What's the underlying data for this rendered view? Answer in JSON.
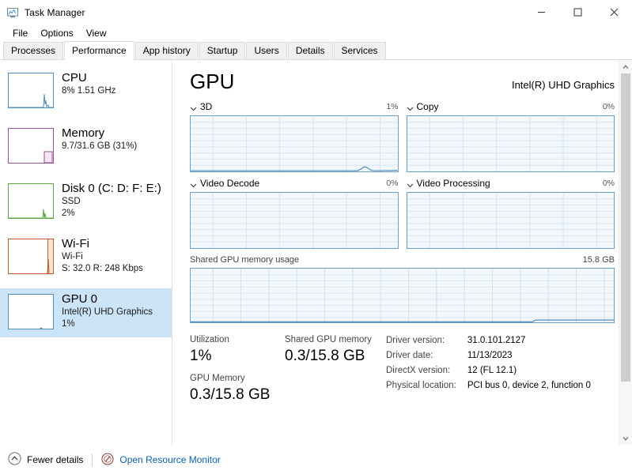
{
  "window": {
    "title": "Task Manager",
    "icon": "task-manager-icon",
    "controls": {
      "minimize": "minimize-icon",
      "maximize": "maximize-icon",
      "close": "close-icon"
    }
  },
  "menu": {
    "items": [
      {
        "label": "File"
      },
      {
        "label": "Options"
      },
      {
        "label": "View"
      }
    ]
  },
  "tabs": {
    "active": "Performance",
    "items": [
      {
        "label": "Processes"
      },
      {
        "label": "Performance"
      },
      {
        "label": "App history"
      },
      {
        "label": "Startup"
      },
      {
        "label": "Users"
      },
      {
        "label": "Details"
      },
      {
        "label": "Services"
      }
    ]
  },
  "sidebar": {
    "items": [
      {
        "title": "CPU",
        "line1": "8%  1.51 GHz",
        "line2": "",
        "line3": "",
        "color": "#4f8fc0",
        "selected": false
      },
      {
        "title": "Memory",
        "line1": "9.7/31.6 GB (31%)",
        "line2": "",
        "line3": "",
        "color": "#9b4f96",
        "selected": false
      },
      {
        "title": "Disk 0 (C: D: F: E:)",
        "line1": "SSD",
        "line2": "2%",
        "line3": "",
        "color": "#5fa343",
        "selected": false
      },
      {
        "title": "Wi-Fi",
        "line1": "Wi-Fi",
        "line2": "S: 32.0 R: 248 Kbps",
        "line3": "",
        "color": "#c0582a",
        "selected": false
      },
      {
        "title": "GPU 0",
        "line1": "Intel(R) UHD Graphics",
        "line2": "1%",
        "line3": "",
        "color": "#4f8fc0",
        "selected": true
      }
    ]
  },
  "main": {
    "title": "GPU",
    "device": "Intel(R) UHD Graphics",
    "graphs": [
      {
        "label": "3D",
        "value": "1%"
      },
      {
        "label": "Copy",
        "value": "0%"
      },
      {
        "label": "Video Decode",
        "value": "0%"
      },
      {
        "label": "Video Processing",
        "value": "0%"
      }
    ],
    "shared": {
      "label": "Shared GPU memory usage",
      "max": "15.8 GB"
    },
    "stats": [
      {
        "name": "Utilization",
        "value": "1%"
      },
      {
        "name": "GPU Memory",
        "value": "0.3/15.8 GB"
      },
      {
        "name": "Shared GPU memory",
        "value": "0.3/15.8 GB"
      }
    ],
    "info": [
      {
        "key": "Driver version:",
        "value": "31.0.101.2127"
      },
      {
        "key": "Driver date:",
        "value": "11/13/2023"
      },
      {
        "key": "DirectX version:",
        "value": "12 (FL 12.1)"
      },
      {
        "key": "Physical location:",
        "value": "PCI bus 0, device 2, function 0"
      }
    ]
  },
  "statusbar": {
    "fewer_details": "Fewer details",
    "fewer_icon": "chevron-up-circle-icon",
    "resource_monitor": "Open Resource Monitor",
    "resource_icon": "resource-monitor-icon"
  },
  "colors": {
    "accent": "#0b5fb0",
    "graph_border": "#6b9ec7",
    "graph_fill": "#f2f7fb",
    "selection": "#cce4f7"
  }
}
